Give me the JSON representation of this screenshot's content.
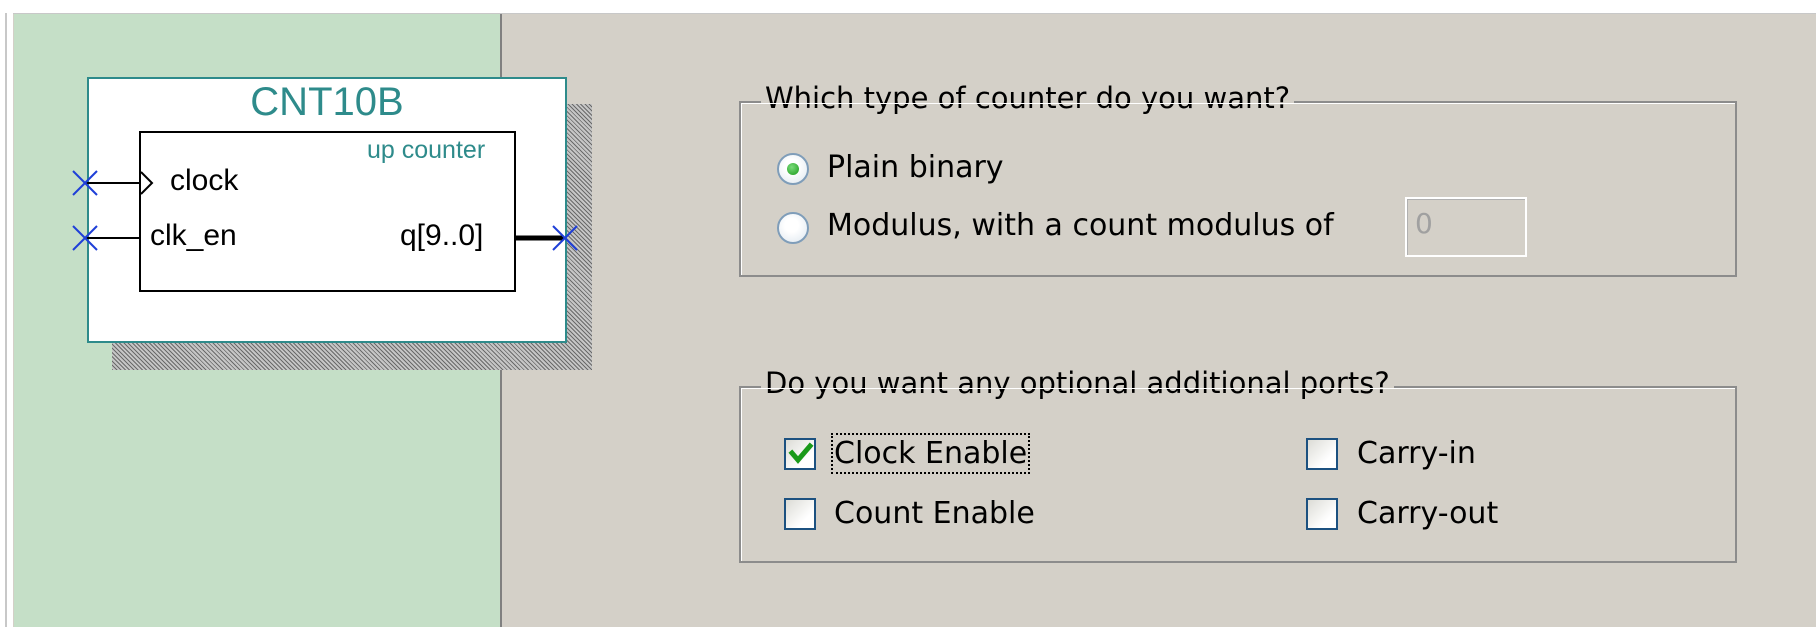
{
  "symbol": {
    "name": "CNT10B",
    "subtitle": "up counter",
    "inputs": [
      "clock",
      "clk_en"
    ],
    "output": "q[9..0]"
  },
  "counter_type": {
    "title": "Which type of counter do you want?",
    "options": [
      {
        "label": "Plain binary",
        "selected": true
      },
      {
        "label": "Modulus, with a count modulus of",
        "selected": false
      }
    ],
    "modulus_value": "0"
  },
  "optional_ports": {
    "title": "Do you want any optional additional ports?",
    "items": [
      {
        "label": "Clock Enable",
        "checked": true
      },
      {
        "label": "Count Enable",
        "checked": false
      },
      {
        "label": "Carry-in",
        "checked": false
      },
      {
        "label": "Carry-out",
        "checked": false
      }
    ]
  },
  "colors": {
    "preview_bg": "#c5dfc7",
    "symbol_accent": "#2e8b8b",
    "check_green": "#1a9a1a",
    "port_x": "#1f3fd8"
  },
  "icons": {
    "pin": "x-marker-icon",
    "check": "checkmark-icon",
    "clock_edge": "clock-triangle-icon"
  }
}
